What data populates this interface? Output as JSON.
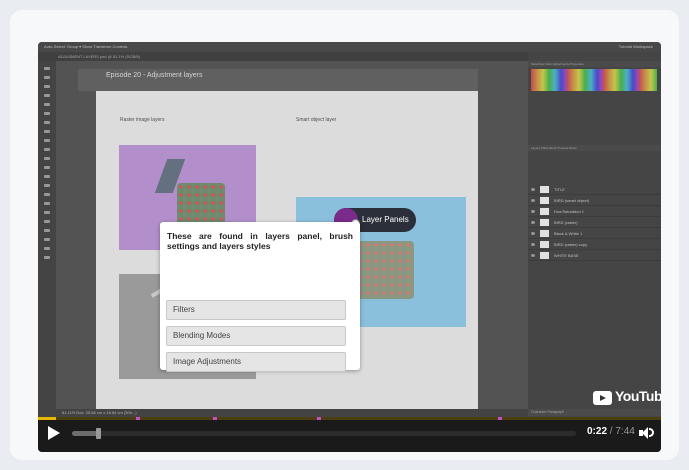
{
  "app": {
    "menu_left": "Auto-Select: Group ▾   Show Transform Controls",
    "menu_right": "Tutorial Workspace",
    "doc_tab": "ADJUSMENT LAYERS.psd @ 81.1% (RGB/8)",
    "episode_title": "Episode 20 - Adjustment layers",
    "label_raster": "Raster image layers",
    "label_smart": "Smart object layer",
    "status": "81.11%  Doc: 25.56 cm x 16.84 cm (300...)",
    "swatch_tabs": "Swatches   Color   Adjustments   Properties",
    "layers_tabs": "Layers   Paths   Brush Presets   Brush",
    "char_tabs": "Character   Paragraph",
    "layers": [
      {
        "name": "TITLE"
      },
      {
        "name": "BIRD (smart object)"
      },
      {
        "name": "Hue/Saturation 1"
      },
      {
        "name": "BIRD (raster)"
      },
      {
        "name": "Black & White 1"
      },
      {
        "name": "BIRD (raster) copy"
      },
      {
        "name": "WHITE BASE"
      }
    ]
  },
  "callout": {
    "label": "Layer Panels"
  },
  "question": {
    "text": "These are found in layers panel, brush settings and layers styles",
    "options": [
      "Filters",
      "Blending Modes",
      "Image Adjustments"
    ]
  },
  "player": {
    "current_time": "0:22",
    "separator": " / ",
    "total_time": "7:44",
    "watermark": "YouTube",
    "progress_fraction": 0.047
  },
  "colors": {
    "accent_progress": "#e6b800",
    "marker": "#c64dc9",
    "callout_dot": "#7b2b8c"
  }
}
